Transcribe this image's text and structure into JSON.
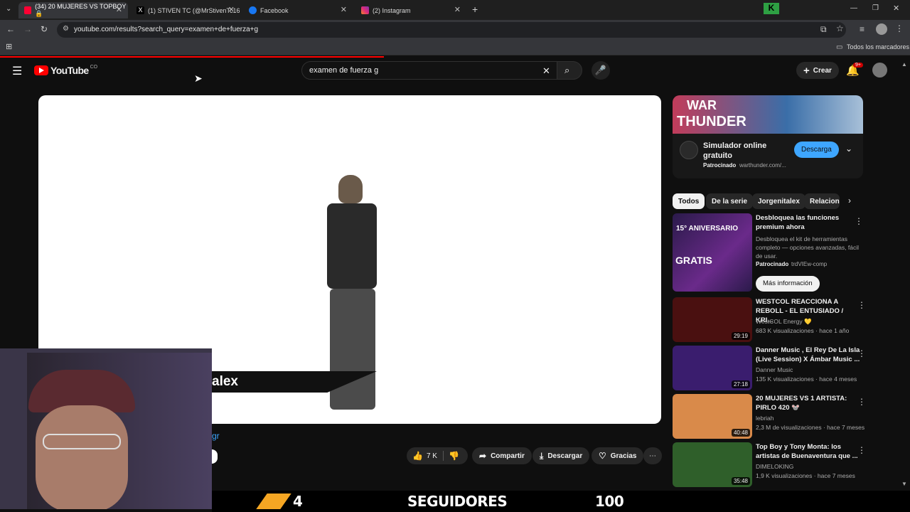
{
  "browser": {
    "tabs": [
      {
        "title": "(34) 20 MUJERES VS TOPBOY 🔒",
        "color": "#ff0033"
      },
      {
        "title": "(1) STIVEN TC (@MrStivenTc16",
        "color": "#ffffff"
      },
      {
        "title": "Facebook",
        "color": "#1877f2"
      },
      {
        "title": "(2) Instagram",
        "color": "#e1306c"
      }
    ],
    "new_tab": "+",
    "url": "youtube.com/results?search_query=examen+de+fuerza+g",
    "bookmarks_label": "Todos los marcadores",
    "ext_badge": "K"
  },
  "youtube": {
    "logo": "YouTube",
    "region": "CO",
    "search_value": "examen de fuerza g",
    "create_label": "Crear",
    "notif_count": "9+"
  },
  "player": {
    "lower_third_text": "alex",
    "link_fragment": "gr"
  },
  "actions": {
    "likes": "7 K",
    "share": "Compartir",
    "download": "Descargar",
    "thanks": "Gracias"
  },
  "ad": {
    "banner_line1": "WAR",
    "banner_line2": "THUNDER",
    "title": "Simulador online gratuito",
    "sponsored": "Patrocinado",
    "domain": "warthunder.com/...",
    "cta": "Descarga"
  },
  "chips": [
    "Todos",
    "De la serie",
    "Jorgenitalex",
    "Relacion"
  ],
  "sidebar_ad": {
    "thumb_top": "15° ANIVERSARIO",
    "thumb_main": "GRATIS",
    "title": "Desbloquea las funciones premium ahora",
    "desc": "Desbloquea el kit de herramientas completo — opciones avanzadas, fácil de usar.",
    "sponsored": "Patrocinado",
    "domain": "trdVIEw-comp",
    "cta": "Más información"
  },
  "videos": [
    {
      "title": "WESTCOL REACCIONA A REBOLL - EL ENTUSIADO / KRI...",
      "channel": "WestCOL Energy 💛",
      "meta": "683 K visualizaciones · hace 1 año",
      "duration": "29:19",
      "thumb_color": "#4a1010"
    },
    {
      "title": "Danner Music , El Rey De La Isla (Live Session) X Ámbar Music ...",
      "channel": "Danner Music",
      "meta": "135 K visualizaciones · hace 4 meses",
      "duration": "27:18",
      "thumb_color": "#3a1d6e"
    },
    {
      "title": "20 MUJERES VS 1 ARTISTA: PIRLO 420 🐭",
      "channel": "lebriah",
      "meta": "2,3 M de visualizaciones · hace 7 meses",
      "duration": "40:48",
      "thumb_color": "#d98a4a"
    },
    {
      "title": "Top Boy y Tony Monta: los artistas de Buenaventura que ...",
      "channel": "DIMELOKING",
      "meta": "1,9 K visualizaciones · hace 7 meses",
      "duration": "35:48",
      "thumb_color": "#2f5f2a"
    }
  ],
  "overlay_bar": {
    "number_left": "4",
    "label": "SEGUIDORES",
    "number_right": "100"
  }
}
